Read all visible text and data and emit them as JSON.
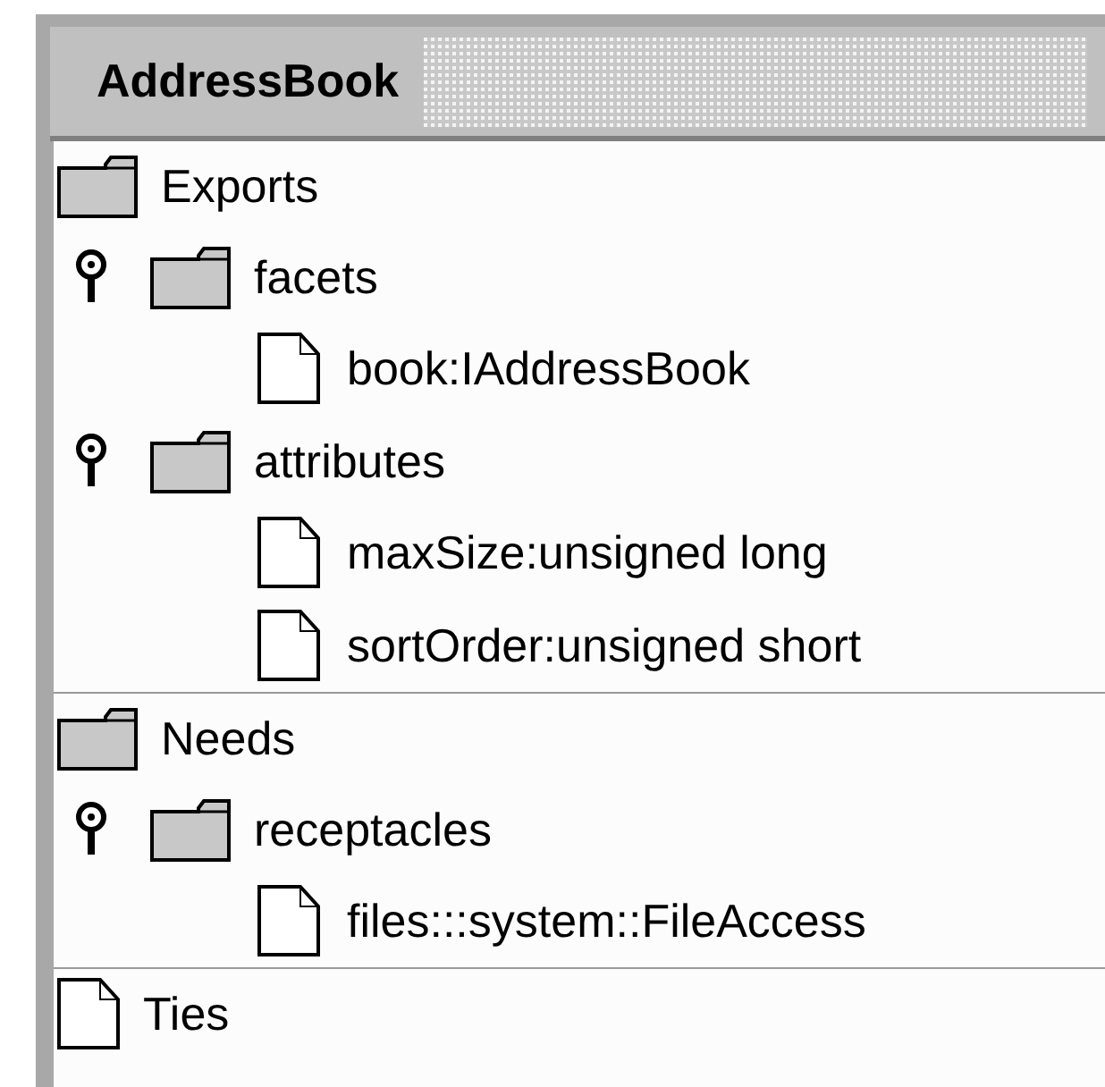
{
  "window": {
    "title": "AddressBook"
  },
  "sections": [
    {
      "label": "Exports",
      "kind": "folder",
      "children": [
        {
          "label": "facets",
          "kind": "folder",
          "expanded": true,
          "children": [
            {
              "label": "book:IAddressBook",
              "kind": "file"
            }
          ]
        },
        {
          "label": "attributes",
          "kind": "folder",
          "expanded": true,
          "children": [
            {
              "label": "maxSize:unsigned long",
              "kind": "file"
            },
            {
              "label": "sortOrder:unsigned short",
              "kind": "file"
            }
          ]
        }
      ]
    },
    {
      "label": "Needs",
      "kind": "folder",
      "children": [
        {
          "label": "receptacles",
          "kind": "folder",
          "expanded": true,
          "children": [
            {
              "label": "files:::system::FileAccess",
              "kind": "file"
            }
          ]
        }
      ]
    },
    {
      "label": "Ties",
      "kind": "file"
    }
  ]
}
